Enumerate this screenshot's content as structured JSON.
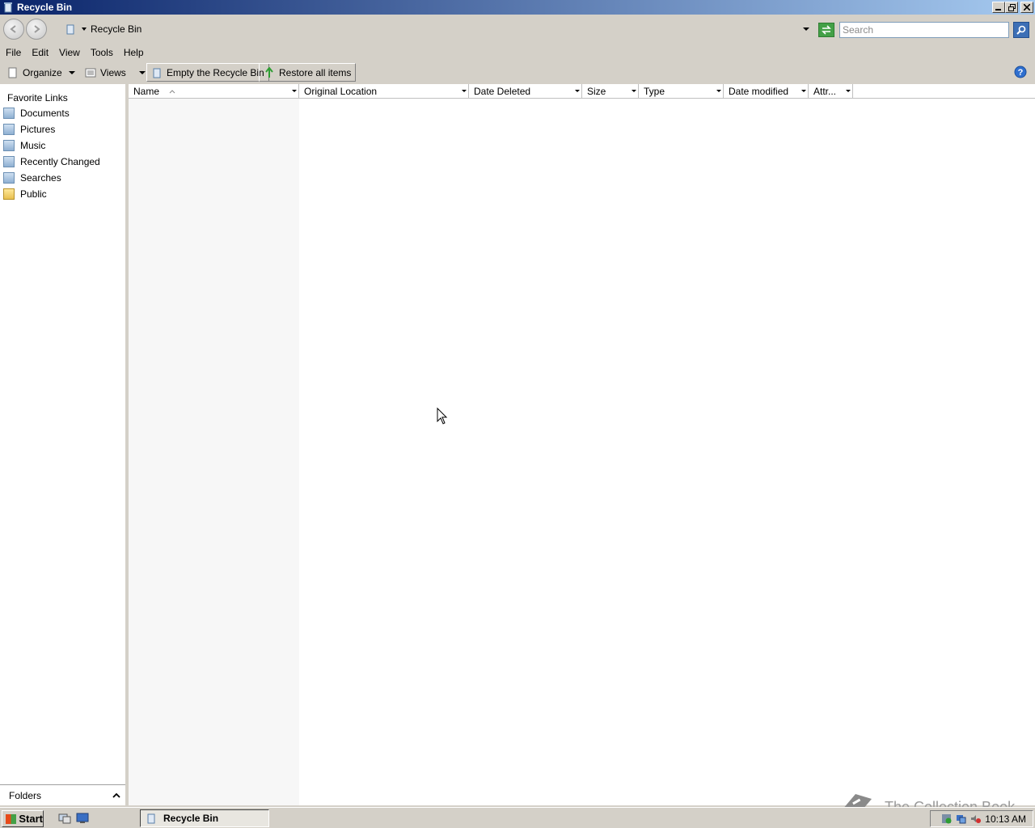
{
  "window": {
    "title": "Recycle Bin"
  },
  "address": {
    "location": "Recycle Bin",
    "search_placeholder": "Search"
  },
  "menu": [
    "File",
    "Edit",
    "View",
    "Tools",
    "Help"
  ],
  "commands": {
    "organize": "Organize",
    "views": "Views",
    "empty": "Empty the Recycle Bin",
    "restore": "Restore all items"
  },
  "nav": {
    "header": "Favorite Links",
    "items": [
      "Documents",
      "Pictures",
      "Music",
      "Recently Changed",
      "Searches",
      "Public"
    ],
    "folders": "Folders"
  },
  "columns": [
    "Name",
    "Original Location",
    "Date Deleted",
    "Size",
    "Type",
    "Date modified",
    "Attr..."
  ],
  "watermark": "The Collection Book",
  "taskbar": {
    "start": "Start",
    "task": "Recycle Bin",
    "clock": "10:13 AM"
  }
}
